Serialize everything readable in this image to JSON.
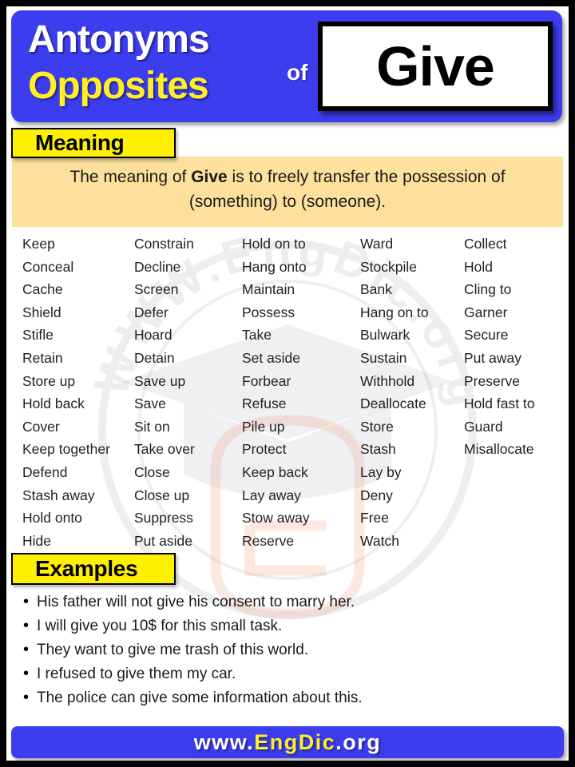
{
  "header": {
    "line1": "Antonyms",
    "line2": "Opposites",
    "connector": "of",
    "word": "Give",
    "colors": {
      "blue": "#3d3df0",
      "yellow": "#ffef26",
      "white": "#ffffff"
    }
  },
  "meaning": {
    "badge_label": "Meaning",
    "prefix": "The meaning of ",
    "bold_word": "Give",
    "suffix": " is to freely transfer the possession of (something) to (someone).",
    "panel_color": "#fce09c"
  },
  "antonym_columns": [
    {
      "index": 1,
      "words": [
        "Keep",
        "Conceal",
        "Cache",
        "Shield",
        "Stifle",
        "Retain",
        "Store up",
        "Hold back",
        "Cover",
        "Keep together",
        "Defend",
        "Stash away",
        "Hold onto",
        "Hide"
      ]
    },
    {
      "index": 2,
      "words": [
        "Constrain",
        "Decline",
        "Screen",
        "Defer",
        "Hoard",
        "Detain",
        "Save up",
        "Save",
        "Sit on",
        "Take over",
        "Close",
        "Close up",
        "Suppress",
        "Put aside"
      ]
    },
    {
      "index": 3,
      "words": [
        "Hold on to",
        "Hang onto",
        "Maintain",
        "Possess",
        "Take",
        "Set aside",
        "Forbear",
        "Refuse",
        "Pile up",
        "Protect",
        "Keep back",
        "Lay away",
        "Stow away",
        "Reserve"
      ]
    },
    {
      "index": 4,
      "words": [
        "Ward",
        "Stockpile",
        "Bank",
        "Hang on to",
        "Bulwark",
        "Sustain",
        "Withhold",
        "Deallocate",
        "Store",
        "Stash",
        "Lay by",
        "Deny",
        "Free",
        "Watch"
      ]
    },
    {
      "index": 5,
      "words": [
        "Collect",
        "Hold",
        "Cling to",
        "Garner",
        "Secure",
        "Put away",
        "Preserve",
        "Hold fast to",
        "Guard",
        "Misallocate"
      ]
    }
  ],
  "examples": {
    "badge_label": "Examples",
    "bullet_glyph": "•",
    "items": [
      "His father will not give his consent to marry her.",
      "I will give you 10$ for this small task.",
      "They want to give me trash of this world.",
      "I refused to give them my car.",
      "The police can give some information about this."
    ]
  },
  "footer": {
    "part1": "www.",
    "part2": "EngDic",
    "part3": ".org"
  },
  "watermark": {
    "ring_text": "WWW.EngDic.org",
    "icon": "graduation-cap"
  }
}
